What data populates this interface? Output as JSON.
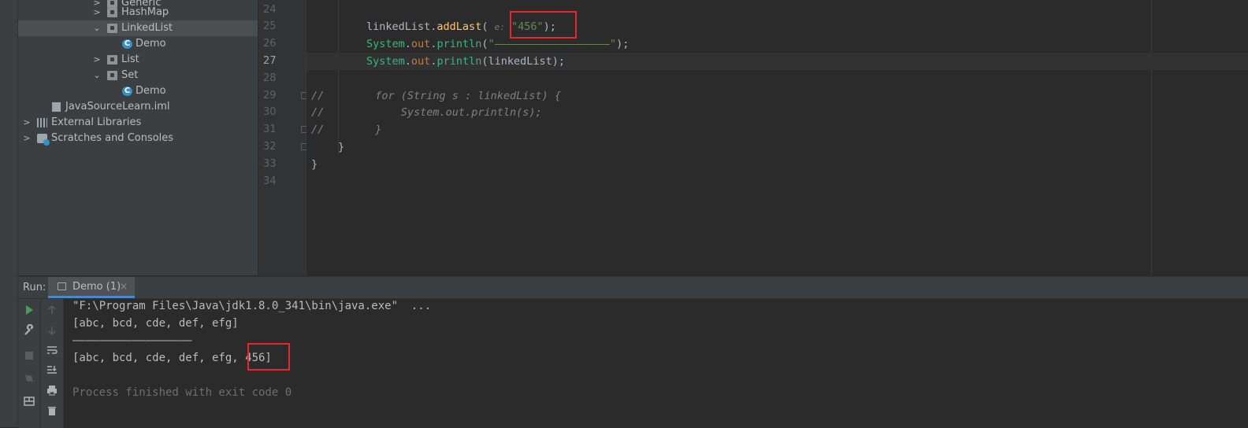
{
  "colors": {
    "highlight_border": "#e5282b",
    "selection": "#4b4f52",
    "tab_underline": "#4a88c7",
    "run_green": "#499c54"
  },
  "project_tree": {
    "items": [
      {
        "label": "Generic",
        "icon": "folder-icon",
        "expanded": false
      },
      {
        "label": "HashMap",
        "icon": "folder-icon",
        "expanded": false
      },
      {
        "label": "LinkedList",
        "icon": "folder-icon",
        "expanded": true,
        "selected": true
      },
      {
        "label": "Demo",
        "icon": "java-class-icon"
      },
      {
        "label": "List",
        "icon": "folder-icon",
        "expanded": false
      },
      {
        "label": "Set",
        "icon": "folder-icon",
        "expanded": true
      },
      {
        "label": "Demo",
        "icon": "java-class-icon"
      },
      {
        "label": "JavaSourceLearn.iml",
        "icon": "module-file-icon"
      },
      {
        "label": "External Libraries",
        "icon": "library-icon",
        "expanded": false
      },
      {
        "label": "Scratches and Consoles",
        "icon": "scratches-icon",
        "expanded": false
      }
    ]
  },
  "editor": {
    "current_line": "27",
    "lines": [
      {
        "n": "24"
      },
      {
        "n": "25",
        "target": "linkedList",
        "method": "addLast",
        "param_hint": "e:",
        "arg": "\"456\"",
        "tail": ");"
      },
      {
        "n": "26",
        "cls": "System",
        "field": "out",
        "method": "println",
        "arg": "\"——————————————————\"",
        "tail": ");"
      },
      {
        "n": "27",
        "cls": "System",
        "field": "out",
        "method": "println",
        "arg": "linkedList",
        "tail": ");"
      },
      {
        "n": "28"
      },
      {
        "n": "29",
        "text": "//        for (String s : linkedList) {"
      },
      {
        "n": "30",
        "text": "//            System.out.println(s);"
      },
      {
        "n": "31",
        "text": "//        }"
      },
      {
        "n": "32",
        "text": "}"
      },
      {
        "n": "33",
        "text": "}"
      },
      {
        "n": "34"
      }
    ]
  },
  "run_panel": {
    "label": "Run:",
    "tab_label": "Demo (1)",
    "tab_close": "×",
    "console": [
      "\"F:\\Program Files\\Java\\jdk1.8.0_341\\bin\\java.exe\"  ...",
      "[abc, bcd, cde, def, efg]",
      "——————————————————",
      "[abc, bcd, cde, def, efg, 456]",
      "",
      "Process finished with exit code 0"
    ]
  }
}
